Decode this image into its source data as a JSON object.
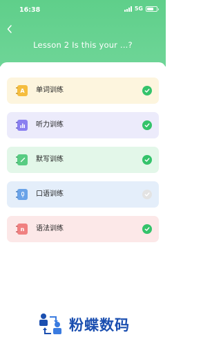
{
  "status_bar": {
    "time": "16:38",
    "network": "5G"
  },
  "header": {
    "title": "Lesson 2 Is this your ...?"
  },
  "items": [
    {
      "label": "单词训练",
      "icon": "letter-a-icon",
      "icon_glyph": "A",
      "bg": "#fdf5de",
      "icon_color": "#f5bd3e",
      "completed": true
    },
    {
      "label": "听力训练",
      "icon": "bar-chart-icon",
      "icon_glyph": "",
      "bg": "#ecebfb",
      "icon_color": "#8a7ff0",
      "completed": true
    },
    {
      "label": "默写训练",
      "icon": "pencil-icon",
      "icon_glyph": "",
      "bg": "#e3f7e9",
      "icon_color": "#58cc82",
      "completed": true
    },
    {
      "label": "口语训练",
      "icon": "microphone-icon",
      "icon_glyph": "",
      "bg": "#e4eefa",
      "icon_color": "#6aa3e8",
      "completed": false
    },
    {
      "label": "语法训练",
      "icon": "letter-n-icon",
      "icon_glyph": "n",
      "bg": "#fce8e8",
      "icon_color": "#f08080",
      "completed": true
    }
  ],
  "colors": {
    "header": "#5fcf8a",
    "check_done": "#34c36b",
    "check_pending": "#e3e3e3"
  },
  "footer": {
    "logo_text": "粉蝶数码"
  }
}
